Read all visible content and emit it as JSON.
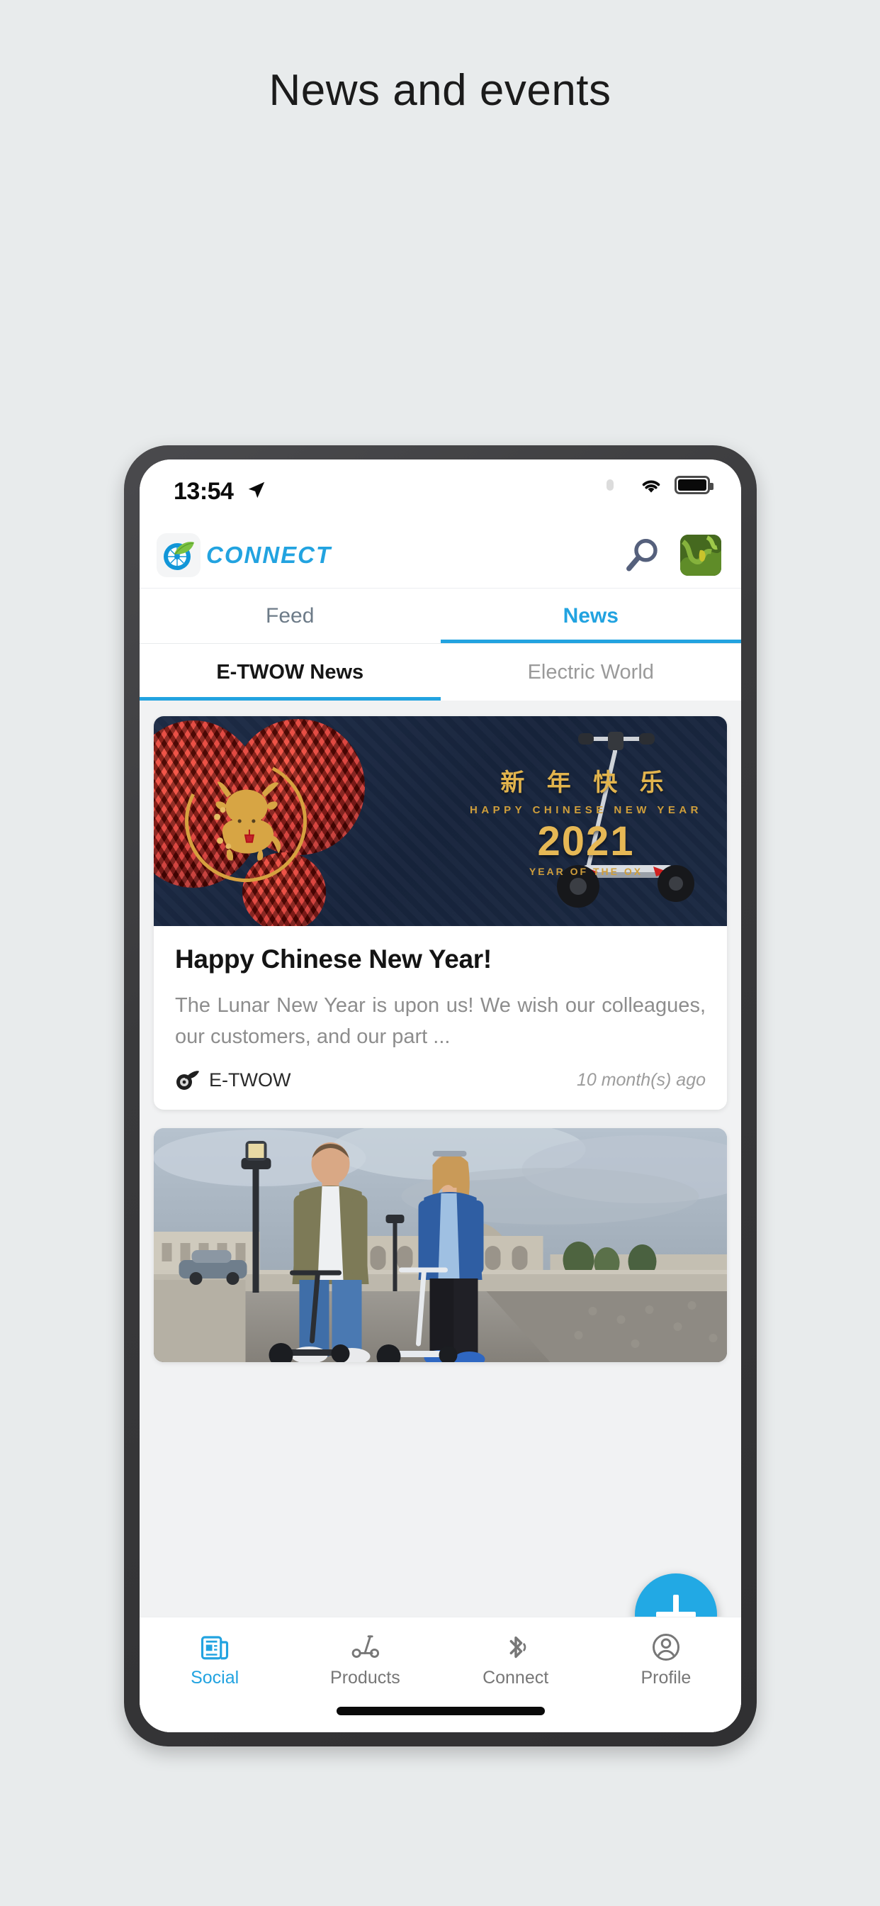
{
  "page": {
    "title": "News and events"
  },
  "status_bar": {
    "time": "13:54",
    "location_icon": "location-arrow-icon",
    "wifi_icon": "wifi-icon",
    "battery_icon": "battery-full-icon"
  },
  "header": {
    "logo_icon": "etwow-wheel-leaf-logo-icon",
    "wordmark": "CONNECT",
    "search_icon": "search-icon",
    "avatar_label": "user-avatar"
  },
  "primary_tabs": [
    {
      "label": "Feed",
      "active": false
    },
    {
      "label": "News",
      "active": true
    }
  ],
  "secondary_tabs": [
    {
      "label": "E-TWOW News",
      "active": true
    },
    {
      "label": "Electric World",
      "active": false
    }
  ],
  "feed": {
    "cards": [
      {
        "banner": {
          "chinese_greeting": "新 年 快 乐",
          "english_greeting": "HAPPY CHINESE NEW YEAR",
          "year": "2021",
          "zodiac": "YEAR OF THE OX"
        },
        "title": "Happy Chinese New Year!",
        "excerpt": "The Lunar New Year is upon us! We wish our colleagues, our customers, and our part ...",
        "author": "E-TWOW",
        "author_icon": "etwow-wheel-icon",
        "timestamp": "10 month(s) ago"
      },
      {
        "photo_alt": "two-riders-on-e-scooters-in-paris"
      }
    ]
  },
  "fab": {
    "icon": "plus-icon",
    "label": "add-post"
  },
  "bottom_nav": [
    {
      "label": "Social",
      "icon": "newspaper-icon",
      "active": true
    },
    {
      "label": "Products",
      "icon": "scooter-icon",
      "active": false
    },
    {
      "label": "Connect",
      "icon": "bluetooth-icon",
      "active": false
    },
    {
      "label": "Profile",
      "icon": "person-circle-icon",
      "active": false
    }
  ],
  "colors": {
    "accent": "#22a3e0",
    "fab": "#22a9e4",
    "page_bg": "#e8ebec",
    "feed_bg": "#f1f2f3",
    "gold": "#d5a33f",
    "navy": "#1b2942"
  }
}
